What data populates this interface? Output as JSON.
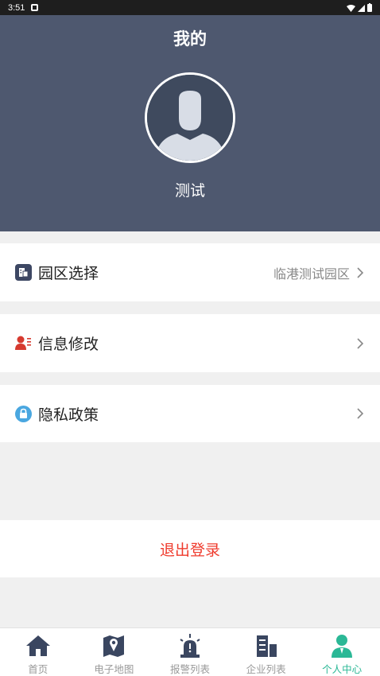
{
  "status_bar": {
    "time": "3:51"
  },
  "header": {
    "title": "我的",
    "username": "测试"
  },
  "menu": [
    {
      "label": "园区选择",
      "value": "临港测试园区",
      "icon": "building-doc-icon"
    },
    {
      "label": "信息修改",
      "value": "",
      "icon": "user-edit-icon"
    },
    {
      "label": "隐私政策",
      "value": "",
      "icon": "lock-icon"
    }
  ],
  "logout_label": "退出登录",
  "tabs": [
    {
      "label": "首页",
      "icon": "home-icon",
      "active": false
    },
    {
      "label": "电子地图",
      "icon": "map-icon",
      "active": false
    },
    {
      "label": "报警列表",
      "icon": "alarm-icon",
      "active": false
    },
    {
      "label": "企业列表",
      "icon": "company-icon",
      "active": false
    },
    {
      "label": "个人中心",
      "icon": "person-icon",
      "active": true
    }
  ],
  "colors": {
    "header_bg": "#4e586f",
    "accent": "#2bb896",
    "logout": "#ef3b2d"
  }
}
